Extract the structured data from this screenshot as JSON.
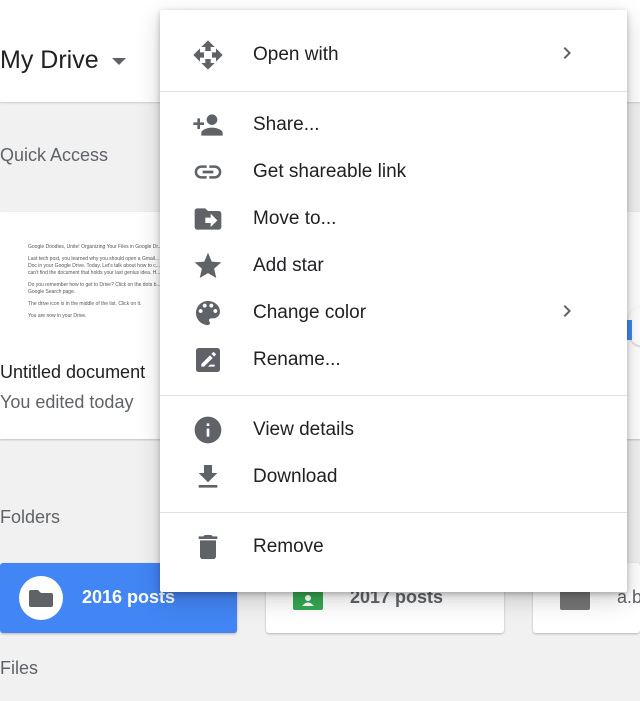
{
  "header": {
    "title": "My Drive"
  },
  "quick_access": {
    "label": "Quick Access",
    "doc": {
      "name": "Untitled document",
      "subtitle": "You edited today",
      "preview_lines": [
        "Google Doodles, Unite! Organizing Your Files in Google Dr...",
        "Last tech post, you learned why you should open a Gmail... Doc in your Google Drive. Today, Let's talk about how to c... can't find the document that holds your last genius idea. H...",
        "Do you remember how to get to Drive? Click on the dots b... Google Search page.",
        "The drive icon is in the middle of the list. Click on it.",
        "You are now in your Drive."
      ]
    }
  },
  "folders": {
    "label": "Folders",
    "items": [
      {
        "name": "2016 posts"
      },
      {
        "name": "2017 posts"
      },
      {
        "name": "a.b"
      }
    ]
  },
  "files": {
    "label": "Files"
  },
  "menu": {
    "items": [
      {
        "label": "Open with",
        "icon": "open-with-icon",
        "submenu": true
      },
      {
        "label": "Share...",
        "icon": "person-add-icon"
      },
      {
        "label": "Get shareable link",
        "icon": "link-icon"
      },
      {
        "label": "Move to...",
        "icon": "move-folder-icon"
      },
      {
        "label": "Add star",
        "icon": "star-icon"
      },
      {
        "label": "Change color",
        "icon": "palette-icon",
        "submenu": true
      },
      {
        "label": "Rename...",
        "icon": "edit-icon"
      },
      {
        "label": "View details",
        "icon": "info-icon"
      },
      {
        "label": "Download",
        "icon": "download-icon"
      },
      {
        "label": "Remove",
        "icon": "trash-icon"
      }
    ]
  },
  "colors": {
    "accent": "#4285f4",
    "icon": "#5f6368",
    "text": "#202124"
  }
}
